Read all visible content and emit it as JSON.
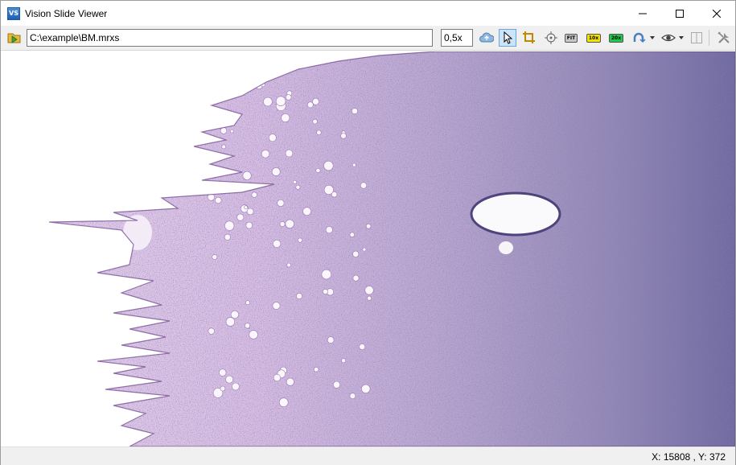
{
  "window": {
    "title": "Vision Slide Viewer",
    "minimize_glyph": "—",
    "maximize_glyph": "☐",
    "close_glyph": "✕"
  },
  "toolbar": {
    "path_value": "C:\\example\\BM.mrxs",
    "zoom_value": "0,5x",
    "fit_label": "FIT",
    "zoom10_label": "10x",
    "zoom20_label": "20x",
    "buttons": [
      {
        "id": "open",
        "icon": "open-folder-icon"
      },
      {
        "id": "upload",
        "icon": "cloud-upload-icon"
      },
      {
        "id": "select",
        "icon": "pointer-icon",
        "active": true
      },
      {
        "id": "crop",
        "icon": "crop-icon"
      },
      {
        "id": "center",
        "icon": "crosshair-icon"
      },
      {
        "id": "rotate",
        "icon": "rotate-icon",
        "dropdown": true
      },
      {
        "id": "view",
        "icon": "eye-icon",
        "dropdown": true
      },
      {
        "id": "split",
        "icon": "split-view-icon"
      },
      {
        "id": "tools",
        "icon": "tools-icon"
      }
    ],
    "colors": {
      "pill_10x": "#f4e200",
      "pill_20x": "#22c84a",
      "pill_fit": "#c8c8c8",
      "active_bg": "#cce4f7"
    }
  },
  "status": {
    "coords": "X: 15808 , Y: 372"
  },
  "slide": {
    "tissue_light": "#d9c2e3",
    "tissue_mid": "#b896cc",
    "tissue_dark": "#5a4f8c"
  }
}
